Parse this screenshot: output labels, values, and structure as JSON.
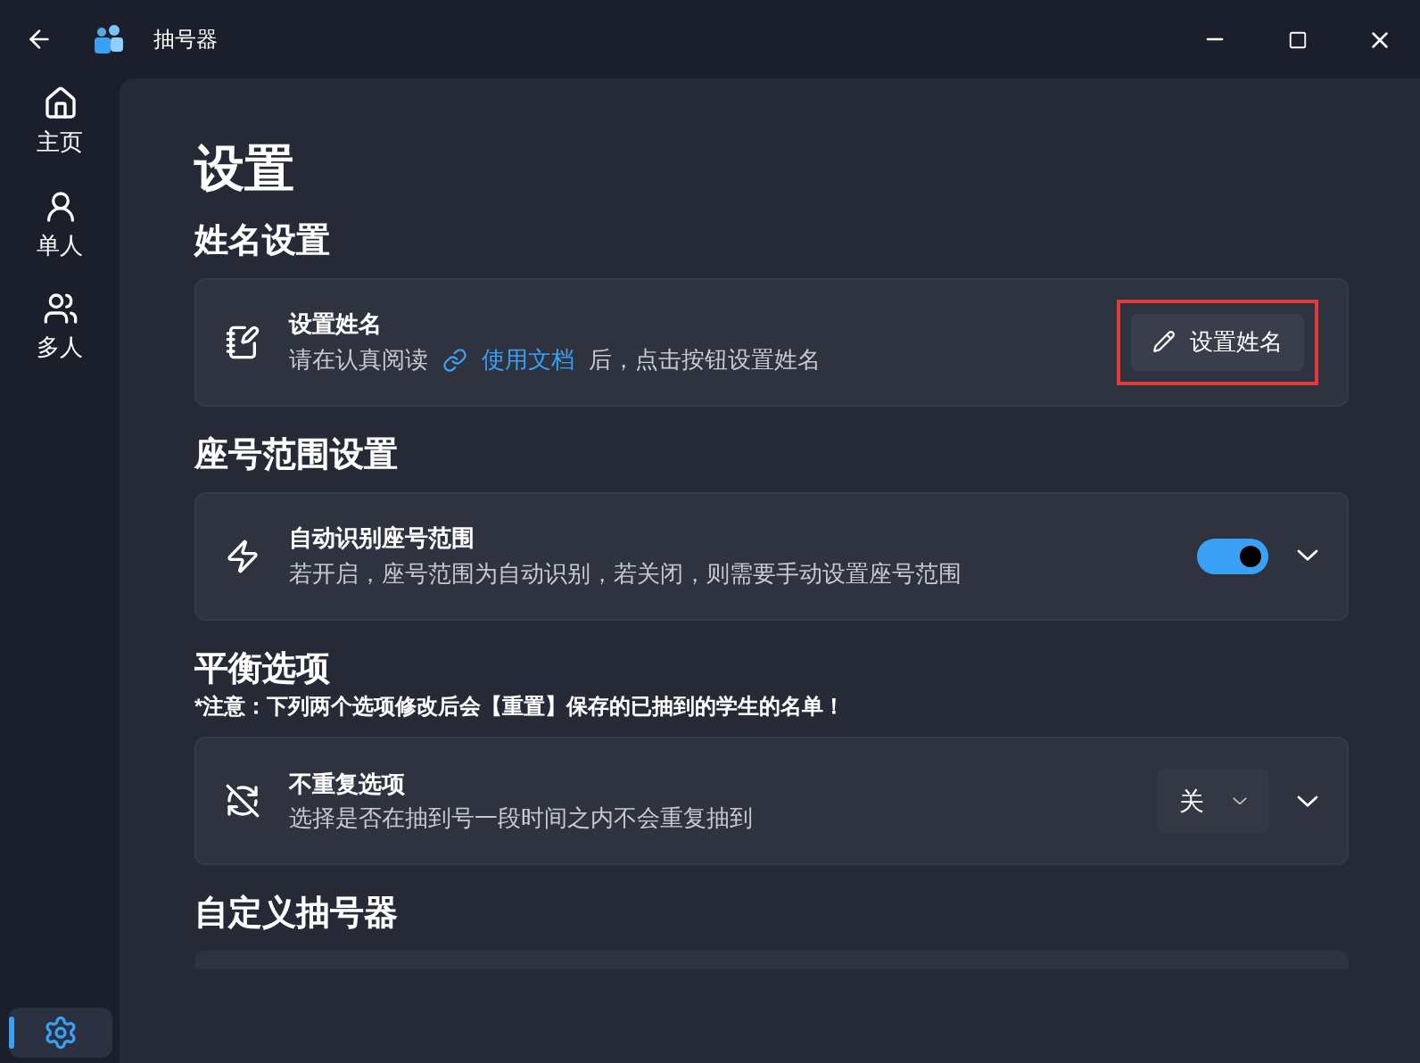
{
  "window": {
    "title": "抽号器"
  },
  "nav": [
    {
      "kind": "home",
      "label": "主页",
      "selected": false
    },
    {
      "kind": "person",
      "label": "单人",
      "selected": false
    },
    {
      "kind": "people",
      "label": "多人",
      "selected": false
    }
  ],
  "nav_footer": {
    "kind": "settings",
    "selected": true
  },
  "page_title": "设置",
  "sections": [
    {
      "title": "姓名设置",
      "cards": [
        {
          "kind": "button",
          "title": "设置姓名",
          "desc_before": "请在认真阅读",
          "link": "使用文档",
          "desc_after": "后，点击按钮设置姓名",
          "button": "设置姓名",
          "highlighted": true
        }
      ]
    },
    {
      "title": "座号范围设置",
      "cards": [
        {
          "kind": "toggle",
          "title": "自动识别座号范围",
          "desc_before": "若开启，座号范围为自动识别，若关闭，则需要手动设置座号范围",
          "on": true
        }
      ]
    },
    {
      "title": "平衡选项",
      "note": "*注意：下列两个选项修改后会【重置】保存的已抽到的学生的名单！",
      "cards": [
        {
          "kind": "select",
          "title": "不重复选项",
          "desc_before": "选择是否在抽到号一段时间之内不会重复抽到",
          "value": "关"
        }
      ]
    },
    {
      "title": "自定义抽号器",
      "cards": [
        {
          "kind": "stub"
        }
      ]
    }
  ]
}
